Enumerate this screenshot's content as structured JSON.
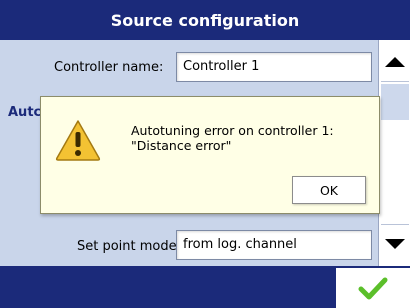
{
  "header": {
    "title": "Source configuration"
  },
  "form": {
    "controller_name_label": "Controller name:",
    "controller_name_value": "Controller 1",
    "section_heading_partial": "Autc",
    "set_point_mode_label": "Set point mode:",
    "set_point_mode_value": "from log. channel"
  },
  "dialog": {
    "message_line1": "Autotuning error on controller 1:",
    "message_line2": "\"Distance error\"",
    "ok_label": "OK",
    "icon": "warning-icon"
  },
  "scrollbar": {
    "up_icon": "arrow-up-icon",
    "down_icon": "arrow-down-icon"
  },
  "footer": {
    "confirm_icon": "checkmark-icon"
  },
  "colors": {
    "title_bar": "#1b2a7a",
    "content_bg": "#c9d5ea",
    "dialog_bg": "#ffffe6",
    "confirm_check": "#5bbf2a",
    "warning_fill": "#f3c233"
  }
}
